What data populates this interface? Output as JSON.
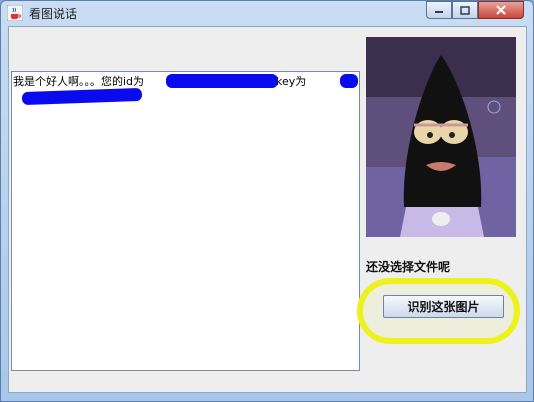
{
  "window": {
    "title": "看图说话"
  },
  "controls": {
    "minimize": "minimize",
    "maximize": "maximize",
    "close": "close"
  },
  "output": {
    "prefix": "我是个好人啊。。。您的id为",
    "middle": "您的key为"
  },
  "status_text": "还没选择文件呢",
  "recognize_button": "识别这张图片",
  "colors": {
    "redaction": "#0a0aee",
    "highlight": "#eef21c",
    "client_bg": "#eeeeee"
  }
}
